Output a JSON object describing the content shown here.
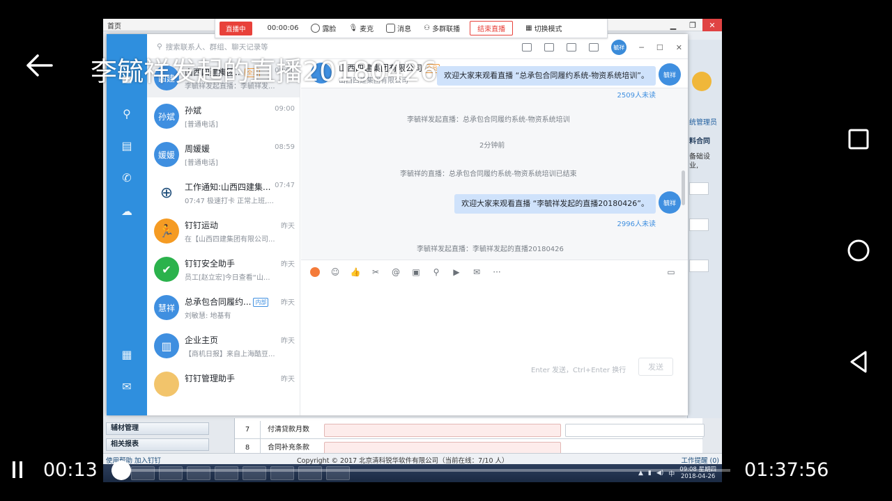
{
  "player": {
    "title": "李毓祥发起的直播20180426",
    "current_time": "00:13",
    "duration": "01:37:56",
    "progress": 0.0023
  },
  "livebar": {
    "status": "直播中",
    "elapsed": "00:00:06",
    "face": "露脸",
    "mic": "麦克",
    "messages": "消息",
    "multi_group": "多群联播",
    "end": "结束直播",
    "switch_mode": "切换模式"
  },
  "bgapp": {
    "tab": "首页",
    "admin_label": "统管理员",
    "side_label": "料合同",
    "side_text": "备础设\n业,",
    "menu1": "辅材管理",
    "menu2": "相关报表",
    "row7_no": "7",
    "row7_label": "付清贷款月数",
    "row8_no": "8",
    "row8_label": "合同补充条款",
    "help": "使用帮助",
    "join": "加入钉钉",
    "copyright": "Copyright © 2017 北京清科锐华软件有限公司（当前在线：7/10 人）",
    "work_reminder": "工作提醒 (0)",
    "clock_time": "09:08 星期四",
    "clock_date": "2018-04-26",
    "tray_ime": "中"
  },
  "dingtalk": {
    "search_placeholder": "搜索联系人、群组、聊天记录等",
    "me": "毓祥",
    "conversations": [
      {
        "name": "山西四建集团...",
        "tag": "全员",
        "time": "09:08",
        "msg": "李毓祥发起直播：李毓祥发...",
        "avatar": "四建"
      },
      {
        "name": "孙斌",
        "time": "09:00",
        "msg": "[普通电话]",
        "avatar": "孙斌"
      },
      {
        "name": "周媛媛",
        "time": "08:59",
        "msg": "[普通电话]",
        "avatar": "媛媛"
      },
      {
        "name": "工作通知:山西四建集...",
        "time": "07:47",
        "msg": "07:47 极速打卡 正常上班,...",
        "avatar": ""
      },
      {
        "name": "钉钉运动",
        "time": "昨天",
        "msg": "在【山西四建集团有限公司...",
        "avatar": ""
      },
      {
        "name": "钉钉安全助手",
        "time": "昨天",
        "msg": "员工[赵立宏]今日查看“山...",
        "avatar": ""
      },
      {
        "name": "总承包合同履约...",
        "tag": "内部",
        "time": "昨天",
        "msg": "刘敏慧: 地基有",
        "avatar": "慧祥"
      },
      {
        "name": "企业主页",
        "time": "昨天",
        "msg": "【商机日报】来自上海酷豆...",
        "avatar": ""
      },
      {
        "name": "钉钉管理助手",
        "time": "昨天",
        "msg": "",
        "avatar": ""
      }
    ],
    "chat": {
      "group_name": "山西四建集团有限公司",
      "group_tag": "全员",
      "group_sub": "山西四建集团有限公司",
      "msg1": "欢迎大家来观看直播 “总承包合同履约系统-物资系统培训”。",
      "unread1": "2509人未读",
      "sys1": "李毓祥发起直播：总承包合同履约系统-物资系统培训",
      "sys2": "2分钟前",
      "sys3": "李毓祥的直播：总承包合同履约系统-物资系统培训已结束",
      "msg2": "欢迎大家来观看直播 “李毓祥发起的直播20180426”。",
      "unread2": "2996人未读",
      "sys4": "李毓祥发起直播：李毓祥发起的直播20180426",
      "sender": "毓祥",
      "input_hint": "Enter 发送，Ctrl+Enter 换行",
      "send": "发送"
    }
  }
}
